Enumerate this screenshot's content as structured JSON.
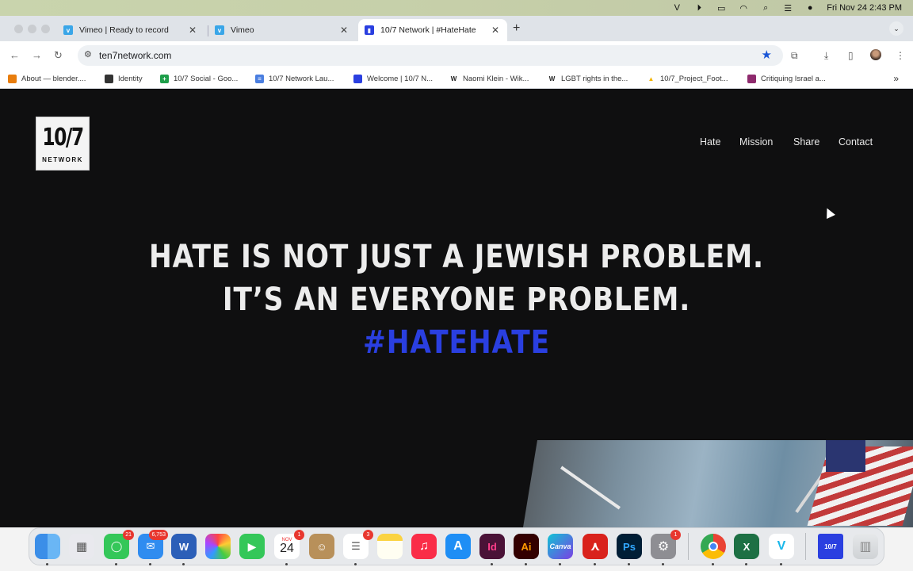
{
  "menubar": {
    "clock": "Fri Nov 24  2:43 PM"
  },
  "tabs": [
    {
      "title": "Vimeo | Ready to record",
      "favicon": "vimeo-icon"
    },
    {
      "title": "Vimeo",
      "favicon": "vimeo-icon"
    },
    {
      "title": "10/7 Network | #HateHate",
      "favicon": "ten7-icon",
      "active": true
    }
  ],
  "toolbar": {
    "url": "ten7network.com"
  },
  "bookmarks": [
    {
      "label": "About — blender....",
      "icon": "blender-icon"
    },
    {
      "label": "Identity",
      "icon": "identity-icon"
    },
    {
      "label": "10/7 Social - Goo...",
      "icon": "sheets-icon"
    },
    {
      "label": "10/7 Network Lau...",
      "icon": "docs-icon"
    },
    {
      "label": "Welcome | 10/7 N...",
      "icon": "ten7-icon"
    },
    {
      "label": "Naomi Klein - Wik...",
      "icon": "wikipedia-icon"
    },
    {
      "label": "LGBT rights in the...",
      "icon": "wikipedia-icon"
    },
    {
      "label": "10/7_Project_Foot...",
      "icon": "drive-icon"
    },
    {
      "label": "Critiquing Israel a...",
      "icon": "bookmark-icon"
    }
  ],
  "site": {
    "logo_num": "10/7",
    "logo_word": "NETWORK",
    "nav": [
      "Hate",
      "Mission",
      "Share",
      "Contact"
    ],
    "hero_line1": "HATE IS NOT JUST A JEWISH PROBLEM.",
    "hero_line2": "IT’S AN EVERYONE PROBLEM.",
    "hero_tag": "#HATEHATE"
  },
  "dock": {
    "messages_badge": "21",
    "mail_badge": "6,753",
    "calendar_month": "NOV",
    "calendar_day": "24",
    "calendar_badge": "1",
    "reminders_badge": "3",
    "settings_badge": "1",
    "labels": {
      "word": "W",
      "indesign": "Id",
      "illustrator": "Ai",
      "canva": "Canva",
      "photoshop": "Ps",
      "excel": "X",
      "vimeo": "V",
      "ten7": "10/7"
    }
  },
  "colors": {
    "accent": "#2a3fe0",
    "page_bg": "#0f0f10"
  }
}
